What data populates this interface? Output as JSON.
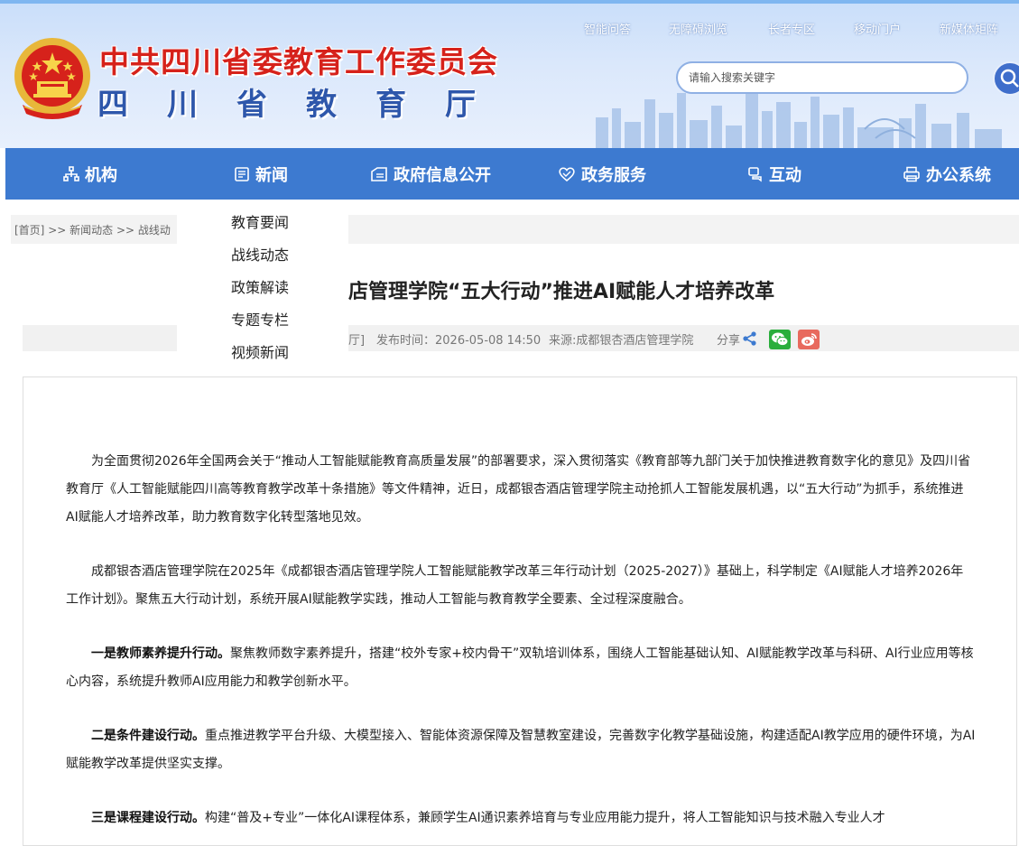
{
  "header": {
    "title_line1": "中共四川省委教育工作委员会",
    "title_line2": "四川省教育厅",
    "top_links": [
      "智能问答",
      "无障碍浏览",
      "长者专区",
      "移动门户",
      "新媒体矩阵"
    ],
    "search_placeholder": "请输入搜索关键字"
  },
  "nav": {
    "items": [
      {
        "label": "机构",
        "icon": "org-icon"
      },
      {
        "label": "新闻",
        "icon": "news-icon"
      },
      {
        "label": "政府信息公开",
        "icon": "info-open-icon"
      },
      {
        "label": "政务服务",
        "icon": "service-icon"
      },
      {
        "label": "互动",
        "icon": "interact-icon"
      },
      {
        "label": "办公系统",
        "icon": "office-icon"
      }
    ]
  },
  "dropdown": {
    "items": [
      "教育要闻",
      "战线动态",
      "政策解读",
      "专题专栏",
      "视频新闻"
    ]
  },
  "breadcrumb": {
    "home": "[首页]",
    "sep": ">>",
    "level1": "新闻动态",
    "level2": "战线动"
  },
  "article": {
    "title": "店管理学院“五大行动”推进AI赋能人才培养改革",
    "meta_prefix": "厅]",
    "publish_time": "发布时间：2026-05-08 14:50",
    "source": "来源:成都银杏酒店管理学院",
    "share_label": "分享",
    "paragraphs": [
      {
        "lead": "",
        "text": "为全面贯彻2026年全国两会关于“推动人工智能赋能教育高质量发展”的部署要求，深入贯彻落实《教育部等九部门关于加快推进教育数字化的意见》及四川省教育厅《人工智能赋能四川高等教育教学改革十条措施》等文件精神，近日，成都银杏酒店管理学院主动抢抓人工智能发展机遇，以“五大行动”为抓手，系统推进AI赋能人才培养改革，助力教育数字化转型落地见效。"
      },
      {
        "lead": "",
        "text": "成都银杏酒店管理学院在2025年《成都银杏酒店管理学院人工智能赋能教学改革三年行动计划（2025-2027）》基础上，科学制定《AI赋能人才培养2026年工作计划》。聚焦五大行动计划，系统开展AI赋能教学实践，推动人工智能与教育教学全要素、全过程深度融合。"
      },
      {
        "lead": "一是教师素养提升行动。",
        "text": "聚焦教师数字素养提升，搭建“校外专家+校内骨干”双轨培训体系，围绕人工智能基础认知、AI赋能教学改革与科研、AI行业应用等核心内容，系统提升教师AI应用能力和教学创新水平。"
      },
      {
        "lead": "二是条件建设行动。",
        "text": "重点推进教学平台升级、大模型接入、智能体资源保障及智慧教室建设，完善数字化教学基础设施，构建适配AI教学应用的硬件环境，为AI赋能教学改革提供坚实支撑。"
      },
      {
        "lead": "三是课程建设行动。",
        "text": "构建“普及+专业”一体化AI课程体系，兼顾学生AI通识素养培育与专业应用能力提升，将人工智能知识与技术融入专业人才"
      }
    ]
  },
  "colors": {
    "nav_bg": "#3d7ad0",
    "title_red": "#d6221b",
    "title_blue": "#2e57ab",
    "wechat": "#2aae3c",
    "weibo": "#e86a5e"
  }
}
